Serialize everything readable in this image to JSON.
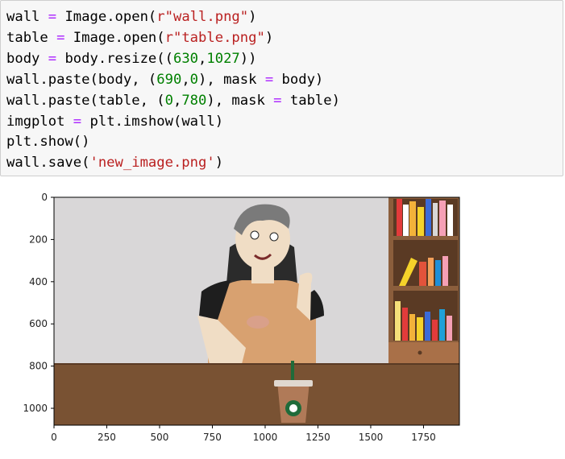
{
  "code_cell": {
    "lines": [
      "wall = Image.open(r\"wall.png\")",
      "table = Image.open(r\"table.png\")",
      "body = body.resize((630,1027))",
      "wall.paste(body, (690,0), mask = body)",
      "wall.paste(table, (0,780), mask = table)",
      "imgplot = plt.imshow(wall)",
      "plt.show()",
      "wall.save('new_image.png')"
    ]
  },
  "chart_data": {
    "type": "image",
    "title": "",
    "xlabel": "",
    "ylabel": "",
    "xlim": [
      0,
      1920
    ],
    "ylim": [
      1080,
      0
    ],
    "x_ticks": [
      "0",
      "250",
      "500",
      "750",
      "1000",
      "1250",
      "1500",
      "1750"
    ],
    "y_ticks": [
      "0",
      "200",
      "400",
      "600",
      "800",
      "1000"
    ],
    "image_content": "cartoon man in tan t-shirt at brown desk with iced coffee cup and bookshelf",
    "colors": {
      "wall": "#d9d7d8",
      "desk": "#795233",
      "shirt": "#d8a170",
      "shelf": "#8b5e3c"
    }
  }
}
